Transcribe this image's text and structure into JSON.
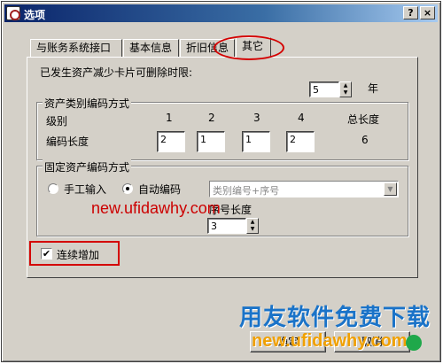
{
  "window": {
    "title": "选项",
    "help_label": "?",
    "close_label": "×"
  },
  "tabs": [
    {
      "label": "与账务系统接口"
    },
    {
      "label": "基本信息"
    },
    {
      "label": "折旧信息"
    },
    {
      "label": "其它"
    }
  ],
  "delete_limit": {
    "label": "已发生资产减少卡片可删除时限:",
    "value": "5",
    "unit": "年"
  },
  "category_coding": {
    "title": "资产类别编码方式",
    "level_label": "级别",
    "length_label": "编码长度",
    "levels": [
      "1",
      "2",
      "3",
      "4"
    ],
    "lengths": [
      "2",
      "1",
      "1",
      "2"
    ],
    "total_label": "总长度",
    "total_value": "6"
  },
  "asset_coding": {
    "title": "固定资产编码方式",
    "manual_label": "手工输入",
    "auto_label": "自动编码",
    "format_value": "类别编号+序号",
    "seq_length_label": "序号长度",
    "seq_length_value": "3",
    "selected": "auto"
  },
  "continuous_add": {
    "label": "连续增加",
    "checked": true,
    "check_glyph": "✔"
  },
  "buttons": {
    "ok_label": "确定",
    "cancel_label": "取消"
  },
  "watermarks": {
    "overlay_url": "new.ufidawhy.com",
    "brand_text": "用友软件免费下载",
    "brand_url": "new.ufidawhy.com"
  },
  "colors": {
    "highlight": "#d40000",
    "titlebar": "#0a246a",
    "brand_blue": "#1a73c8",
    "brand_orange": "#f0a000"
  }
}
